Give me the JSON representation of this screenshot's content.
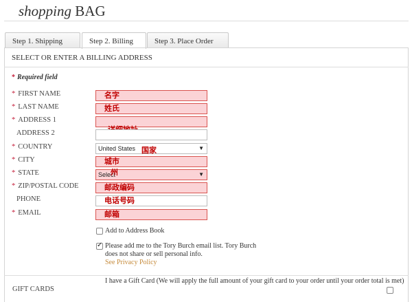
{
  "header": {
    "title_italic": "shopping",
    "title_bold": "BAG"
  },
  "tabs": [
    {
      "label": "Step 1. Shipping"
    },
    {
      "label": "Step 2. Billing"
    },
    {
      "label": "Step 3. Place Order"
    }
  ],
  "section": {
    "title": "SELECT OR ENTER A BILLING ADDRESS"
  },
  "required": {
    "star": "*",
    "text": "Required field"
  },
  "fields": {
    "first_name": {
      "label": "FIRST NAME",
      "value": "名字"
    },
    "last_name": {
      "label": "LAST NAME",
      "value": "姓氏"
    },
    "address1": {
      "label": "ADDRESS 1",
      "value": ""
    },
    "address_note": "详细地址",
    "address2": {
      "label": "ADDRESS 2",
      "value": ""
    },
    "country": {
      "label": "COUNTRY",
      "value": "United States",
      "note": "国家"
    },
    "city": {
      "label": "CITY",
      "value": "城市"
    },
    "state": {
      "label": "STATE",
      "value": "Select",
      "note": "州"
    },
    "zip": {
      "label": "ZIP/POSTAL CODE",
      "value": "邮政编码"
    },
    "phone": {
      "label": "PHONE",
      "value": "电话号码"
    },
    "email": {
      "label": "EMAIL",
      "value": "邮箱"
    }
  },
  "address_book": {
    "label": "Add to Address Book",
    "checked": false
  },
  "email_list": {
    "line1": "Please add me to the Tory Burch email list. Tory Burch",
    "line2": "does not share or sell personal info.",
    "link": "See Privacy Policy",
    "checked": true
  },
  "gift": {
    "label": "GIFT CARDS",
    "text": "I have a Gift Card (We will apply the full amount of your gift card to your order until your order total is met)",
    "checked": false
  },
  "colors": {
    "error_fill": "#fbd3d6",
    "error_border": "#d9534f",
    "annotation": "#c00000",
    "link": "#c58a3a"
  }
}
